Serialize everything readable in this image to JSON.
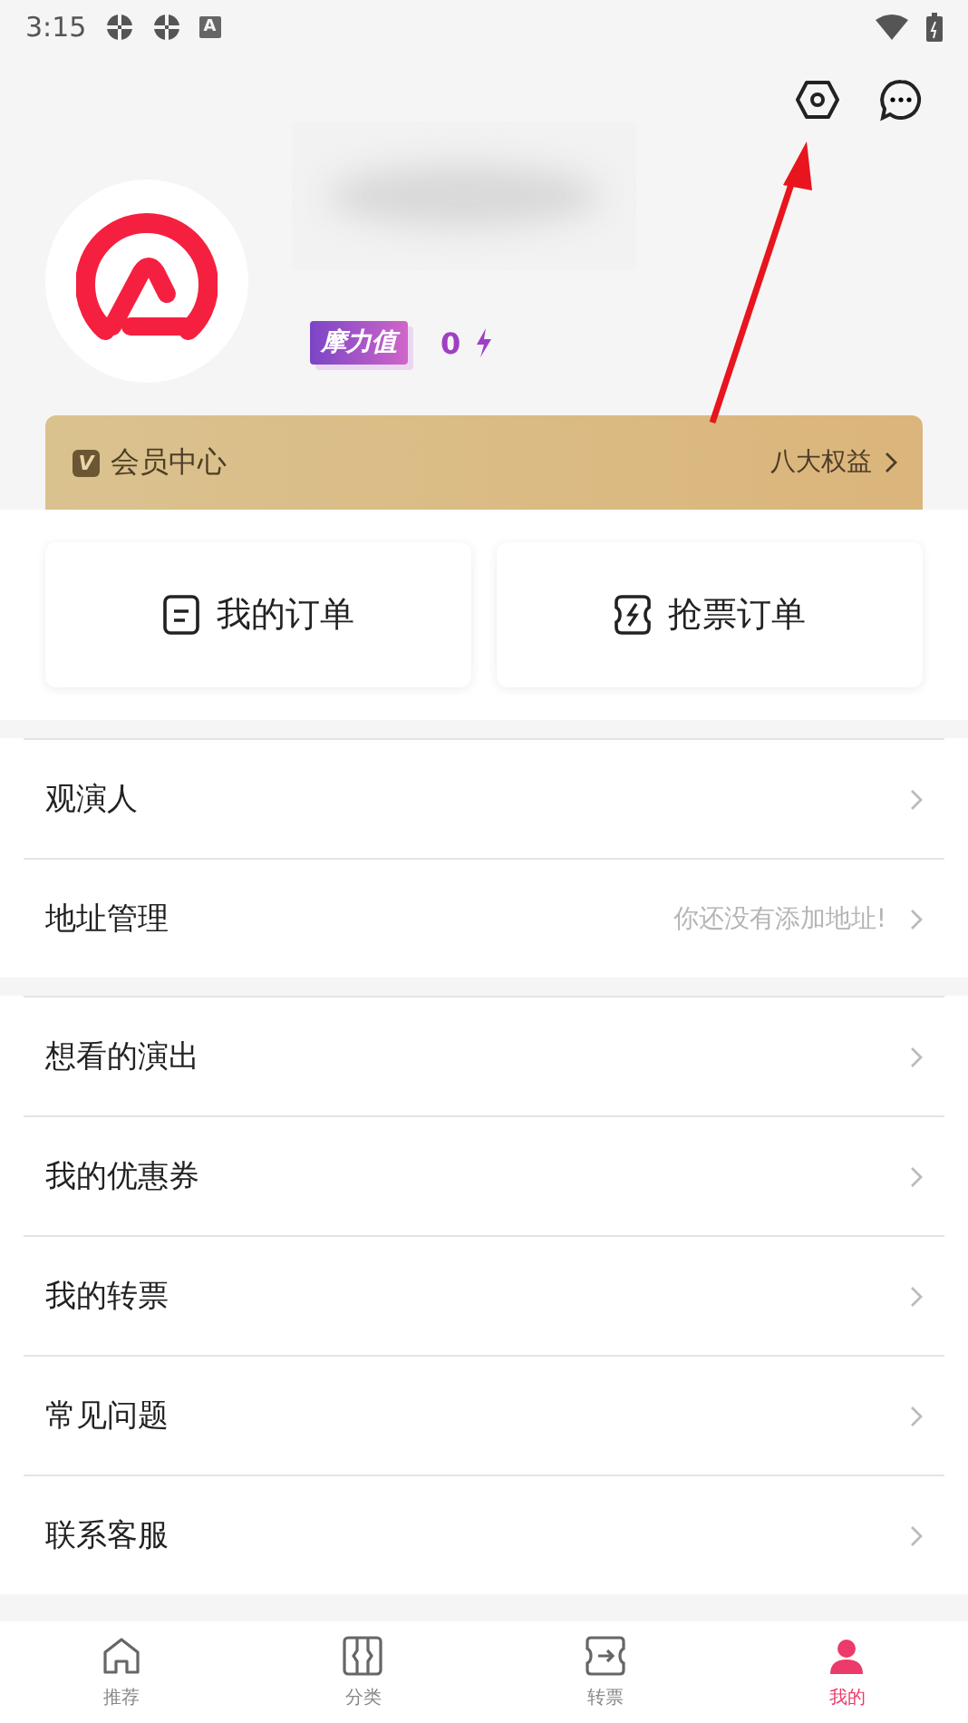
{
  "status_bar": {
    "time": "3:15",
    "notice_letter": "A"
  },
  "profile": {
    "badge": "摩力值",
    "points": "0"
  },
  "member_card": {
    "badge_letter": "V",
    "title": "会员中心",
    "link": "八大权益"
  },
  "order_buttons": [
    {
      "label": "我的订单",
      "kind": "order"
    },
    {
      "label": "抢票订单",
      "kind": "ticket"
    }
  ],
  "menu_groups": [
    {
      "items": [
        {
          "label": "观演人"
        },
        {
          "label": "地址管理",
          "hint": "你还没有添加地址!"
        }
      ]
    },
    {
      "items": [
        {
          "label": "想看的演出"
        },
        {
          "label": "我的优惠券"
        },
        {
          "label": "我的转票"
        },
        {
          "label": "常见问题"
        },
        {
          "label": "联系客服"
        }
      ]
    }
  ],
  "tab_bar": [
    {
      "label": "推荐",
      "kind": "home",
      "selected": false
    },
    {
      "label": "分类",
      "kind": "category",
      "selected": false
    },
    {
      "label": "转票",
      "kind": "transfer",
      "selected": false
    },
    {
      "label": "我的",
      "kind": "profile",
      "selected": true
    }
  ]
}
